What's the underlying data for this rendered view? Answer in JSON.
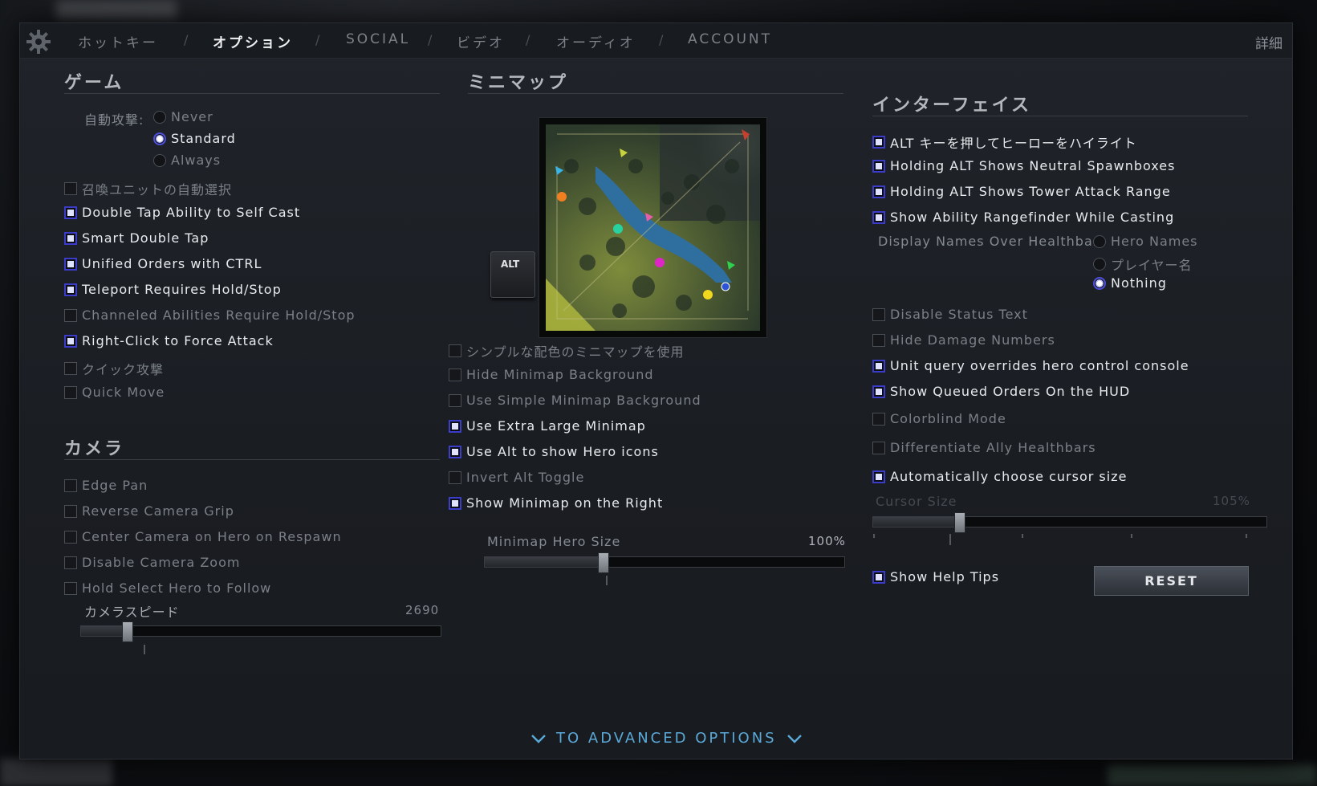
{
  "topbar": {
    "tabs": [
      {
        "label": "ホットキー",
        "active": false
      },
      {
        "label": "オプション",
        "active": true
      },
      {
        "label": "SOCIAL",
        "active": false
      },
      {
        "label": "ビデオ",
        "active": false
      },
      {
        "label": "オーディオ",
        "active": false
      },
      {
        "label": "ACCOUNT",
        "active": false
      }
    ],
    "separator": "/",
    "details_label": "詳細"
  },
  "game": {
    "title": "ゲーム",
    "auto_attack_label": "自動攻撃:",
    "auto_attack_options": [
      {
        "label": "Never",
        "selected": false
      },
      {
        "label": "Standard",
        "selected": true
      },
      {
        "label": "Always",
        "selected": false
      }
    ],
    "checkboxes": [
      {
        "label": "召喚ユニットの自動選択",
        "checked": false
      },
      {
        "label": "Double Tap Ability to Self Cast",
        "checked": true
      },
      {
        "label": "Smart Double Tap",
        "checked": true
      },
      {
        "label": "Unified Orders with CTRL",
        "checked": true
      },
      {
        "label": "Teleport Requires Hold/Stop",
        "checked": true
      },
      {
        "label": "Channeled Abilities Require Hold/Stop",
        "checked": false
      },
      {
        "label": "Right-Click to Force Attack",
        "checked": true
      },
      {
        "label": "クイック攻撃",
        "checked": false
      },
      {
        "label": "Quick Move",
        "checked": false
      }
    ]
  },
  "camera": {
    "title": "カメラ",
    "checkboxes": [
      {
        "label": "Edge Pan",
        "checked": false
      },
      {
        "label": "Reverse Camera Grip",
        "checked": false
      },
      {
        "label": "Center Camera on Hero on Respawn",
        "checked": false
      },
      {
        "label": "Disable Camera Zoom",
        "checked": false
      },
      {
        "label": "Hold Select Hero to Follow",
        "checked": false
      }
    ],
    "speed_label": "カメラスピード",
    "speed_value": "2690",
    "speed_fraction": 0.13
  },
  "minimap": {
    "title": "ミニマップ",
    "alt_key_label": "ALT",
    "checkboxes": [
      {
        "label": "シンプルな配色のミニマップを使用",
        "checked": false
      },
      {
        "label": "Hide Minimap Background",
        "checked": false
      },
      {
        "label": "Use Simple Minimap Background",
        "checked": false
      },
      {
        "label": "Use Extra Large Minimap",
        "checked": true
      },
      {
        "label": "Use Alt to show Hero icons",
        "checked": true
      },
      {
        "label": "Invert Alt Toggle",
        "checked": false
      },
      {
        "label": "Show Minimap on the Right",
        "checked": true
      }
    ],
    "hero_size_label": "Minimap Hero Size",
    "hero_size_value": "100%",
    "hero_size_fraction": 0.33
  },
  "interface": {
    "title": "インターフェイス",
    "checkboxes_top": [
      {
        "label": "ALT キーを押してヒーローをハイライト",
        "checked": true
      },
      {
        "label": "Holding ALT Shows Neutral Spawnboxes",
        "checked": true
      },
      {
        "label": "Holding ALT Shows Tower Attack Range",
        "checked": true
      },
      {
        "label": "Show Ability Rangefinder While Casting",
        "checked": true
      }
    ],
    "display_names_label": "Display Names Over Healthbar",
    "display_names_options": [
      {
        "label": "Hero Names",
        "selected": false
      },
      {
        "label": "プレイヤー名",
        "selected": false
      },
      {
        "label": "Nothing",
        "selected": true
      }
    ],
    "checkboxes_bottom": [
      {
        "label": "Disable Status Text",
        "checked": false
      },
      {
        "label": "Hide Damage Numbers",
        "checked": false
      },
      {
        "label": "Unit query overrides hero control console",
        "checked": true
      },
      {
        "label": "Show Queued Orders On the HUD",
        "checked": true
      },
      {
        "label": "Colorblind Mode",
        "checked": false
      },
      {
        "label": "Differentiate Ally Healthbars",
        "checked": false
      },
      {
        "label": "Automatically choose cursor size",
        "checked": true
      }
    ],
    "cursor_size_label": "Cursor Size",
    "cursor_size_value": "105%",
    "cursor_size_fraction": 0.22,
    "help_tips": {
      "label": "Show Help Tips",
      "checked": true
    },
    "reset_label": "RESET"
  },
  "advanced_link": "TO ADVANCED OPTIONS",
  "colors": {
    "accent_blue": "#5aa9d8",
    "checkbox_on": "#3b3cc9",
    "panel_bg": "#1c1f24"
  }
}
